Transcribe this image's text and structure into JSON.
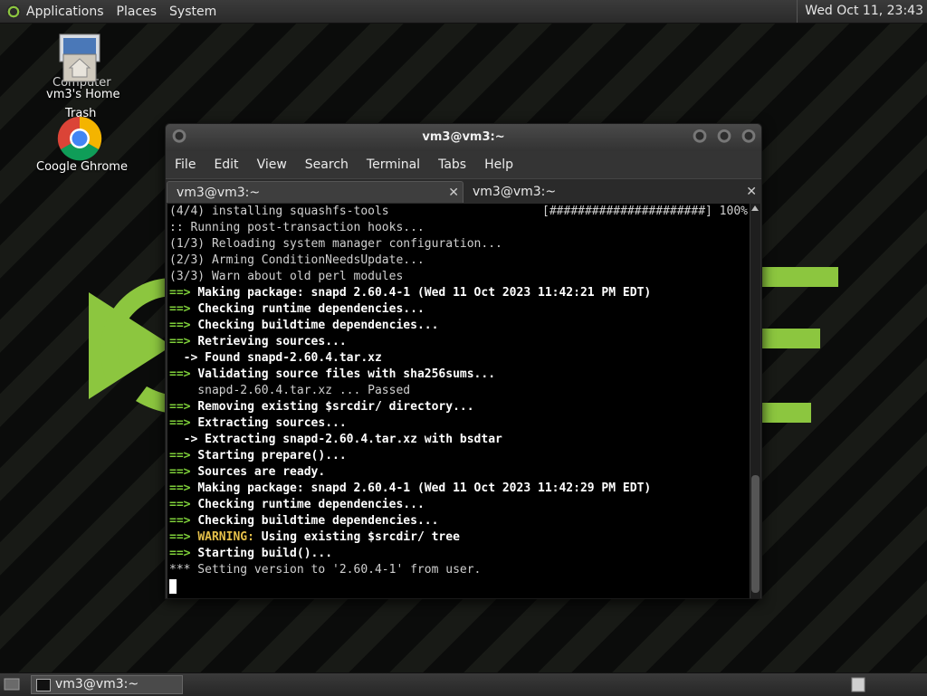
{
  "top_panel": {
    "menus": [
      "Applications",
      "Places",
      "System"
    ],
    "clock": "Wed Oct 11, 23:43"
  },
  "desktop_icons": {
    "computer": "Computer",
    "home": "vm3's Home",
    "trash": "Trash",
    "chrome": "Coogle Ghrome"
  },
  "window": {
    "title": "vm3@vm3:~",
    "menus": [
      "File",
      "Edit",
      "View",
      "Search",
      "Terminal",
      "Tabs",
      "Help"
    ],
    "tabs": [
      {
        "label": "vm3@vm3:~",
        "active": true
      },
      {
        "label": "vm3@vm3:~",
        "active": false
      }
    ],
    "progress_bar": "[######################] 100%",
    "lines": [
      {
        "type": "plain",
        "text": "(4/4) installing squashfs-tools"
      },
      {
        "type": "plain",
        "text": ":: Running post-transaction hooks..."
      },
      {
        "type": "plain",
        "text": "(1/3) Reloading system manager configuration..."
      },
      {
        "type": "plain",
        "text": "(2/3) Arming ConditionNeedsUpdate..."
      },
      {
        "type": "plain",
        "text": "(3/3) Warn about old perl modules"
      },
      {
        "type": "step",
        "text": "Making package: snapd 2.60.4-1 (Wed 11 Oct 2023 11:42:21 PM EDT)"
      },
      {
        "type": "step",
        "text": "Checking runtime dependencies..."
      },
      {
        "type": "step",
        "text": "Checking buildtime dependencies..."
      },
      {
        "type": "step",
        "text": "Retrieving sources..."
      },
      {
        "type": "sub",
        "text": "Found snapd-2.60.4.tar.xz"
      },
      {
        "type": "step",
        "text": "Validating source files with sha256sums..."
      },
      {
        "type": "plain",
        "text": "    snapd-2.60.4.tar.xz ... Passed"
      },
      {
        "type": "step",
        "text": "Removing existing $srcdir/ directory..."
      },
      {
        "type": "step",
        "text": "Extracting sources..."
      },
      {
        "type": "sub",
        "text": "Extracting snapd-2.60.4.tar.xz with bsdtar"
      },
      {
        "type": "step",
        "text": "Starting prepare()..."
      },
      {
        "type": "step",
        "text": "Sources are ready."
      },
      {
        "type": "step",
        "text": "Making package: snapd 2.60.4-1 (Wed 11 Oct 2023 11:42:29 PM EDT)"
      },
      {
        "type": "step",
        "text": "Checking runtime dependencies..."
      },
      {
        "type": "step",
        "text": "Checking buildtime dependencies..."
      },
      {
        "type": "warning",
        "label": "WARNING:",
        "text": "Using existing $srcdir/ tree"
      },
      {
        "type": "step",
        "text": "Starting build()..."
      },
      {
        "type": "plain",
        "text": "*** Setting version to '2.60.4-1' from user."
      }
    ]
  },
  "taskbar": {
    "task_label": "vm3@vm3:~"
  },
  "colors": {
    "accent_green": "#8cc63f",
    "terminal_arrow": "#7fd03a",
    "warning": "#e5c04a"
  }
}
